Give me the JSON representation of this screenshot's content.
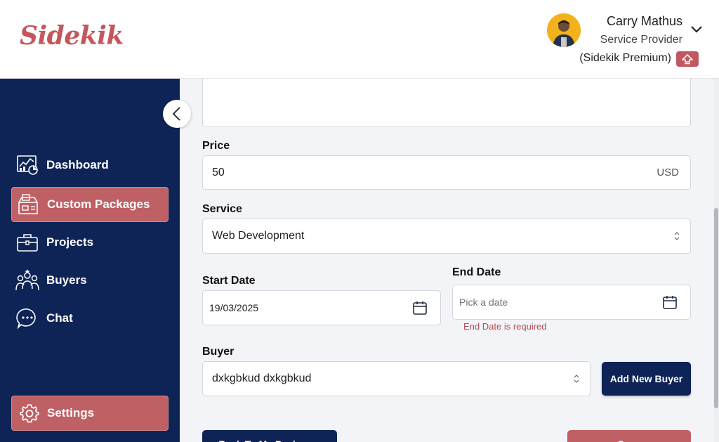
{
  "header": {
    "logo": "Sidekik",
    "user_name": "Carry Mathus",
    "user_role": "Service Provider",
    "user_plan": "(Sidekik Premium)"
  },
  "sidebar": {
    "items": [
      {
        "label": "Dashboard",
        "icon": "dashboard-icon",
        "active": false
      },
      {
        "label": "Custom Packages",
        "icon": "package-icon",
        "active": true
      },
      {
        "label": "Projects",
        "icon": "briefcase-icon",
        "active": false
      },
      {
        "label": "Buyers",
        "icon": "users-icon",
        "active": false
      },
      {
        "label": "Chat",
        "icon": "chat-icon",
        "active": false
      }
    ],
    "settings_label": "Settings"
  },
  "form": {
    "price_label": "Price",
    "price_value": "50",
    "price_currency": "USD",
    "service_label": "Service",
    "service_value": "Web Development",
    "start_date_label": "Start Date",
    "start_date_value": "19/03/2025",
    "end_date_label": "End Date",
    "end_date_placeholder": "Pick a date",
    "end_date_error": "End Date is required",
    "buyer_label": "Buyer",
    "buyer_value": "dxkgbkud dxkgbkud",
    "add_buyer_label": "Add New Buyer",
    "back_label": "Back To My Packages",
    "save_label": "Save"
  },
  "colors": {
    "brand": "#c4575c",
    "sidebar_bg": "#0f2456",
    "active_item": "#bf6064",
    "error": "#b54b52"
  }
}
